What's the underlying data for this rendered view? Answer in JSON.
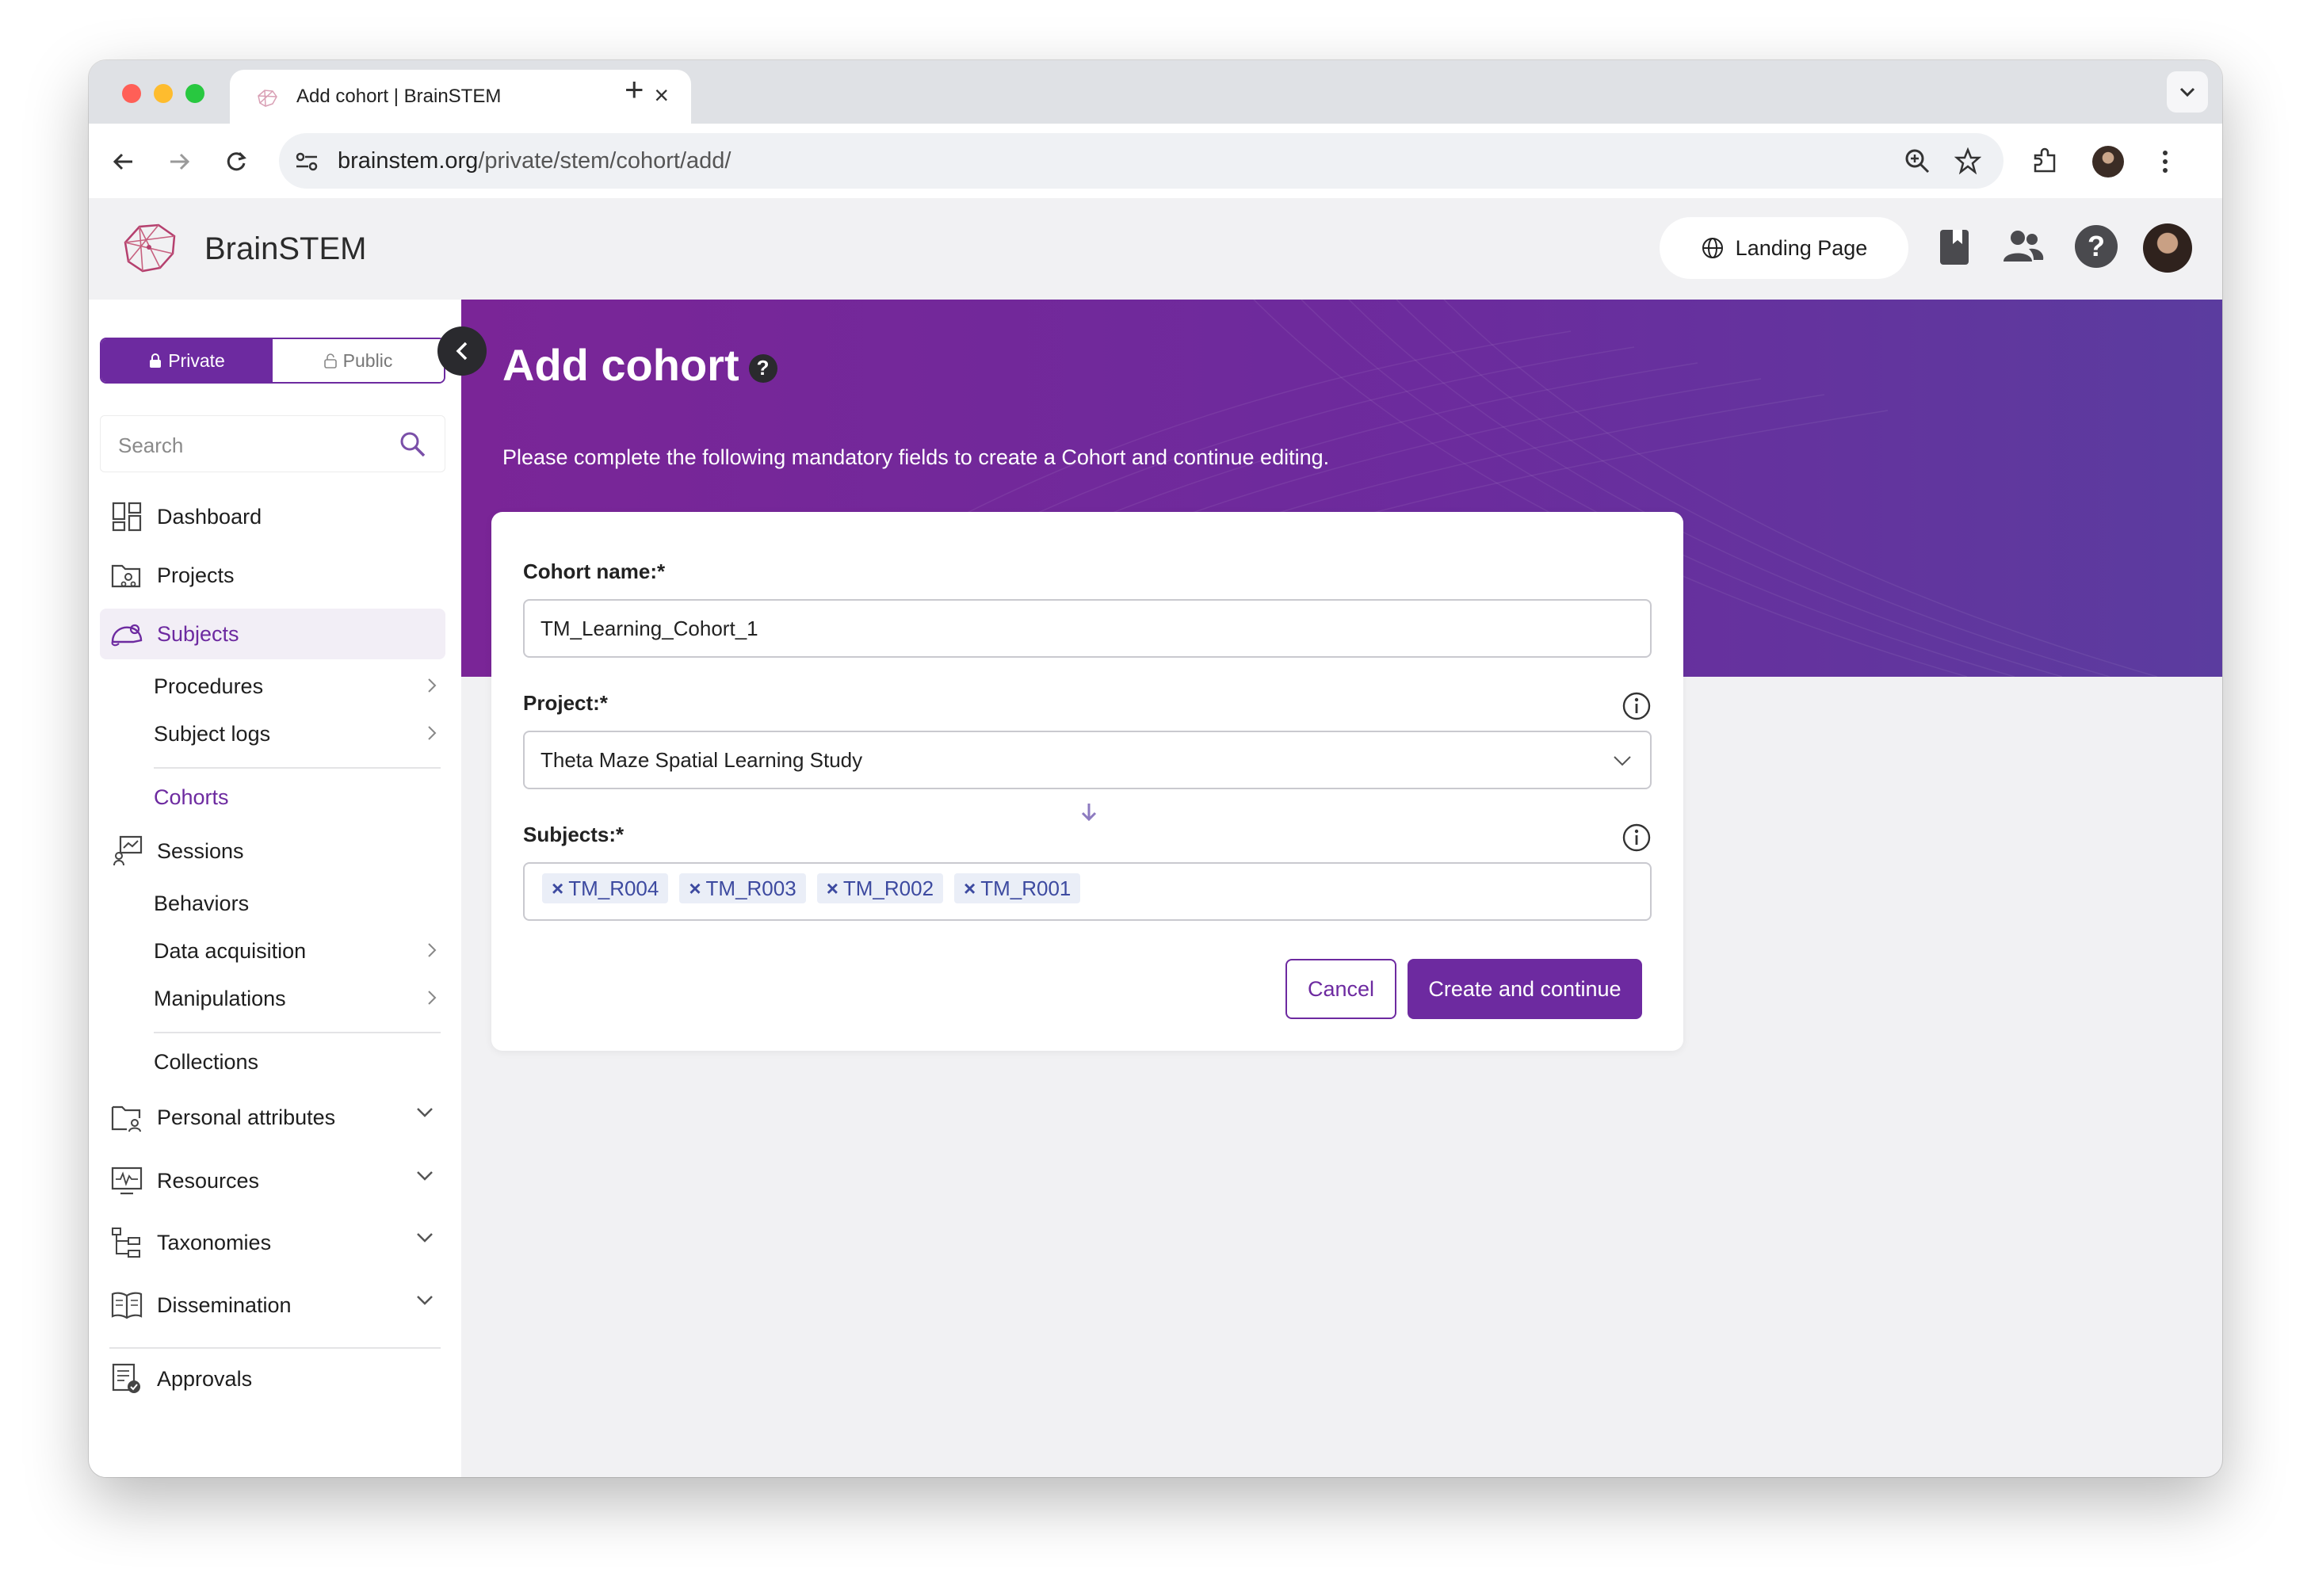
{
  "browser": {
    "tab_title": "Add cohort | BrainSTEM",
    "tab_close": "×",
    "new_tab": "+",
    "url_host": "brainstem.org",
    "url_path": "/private/stem/cohort/add/"
  },
  "header": {
    "brand": "BrainSTEM",
    "landing_page": "Landing Page",
    "help_label": "?"
  },
  "sidebar": {
    "mode_private": "Private",
    "mode_public": "Public",
    "search_placeholder": "Search",
    "items": {
      "dashboard": "Dashboard",
      "projects": "Projects",
      "subjects": "Subjects",
      "procedures": "Procedures",
      "subject_logs": "Subject logs",
      "cohorts": "Cohorts",
      "sessions": "Sessions",
      "behaviors": "Behaviors",
      "data_acquisition": "Data acquisition",
      "manipulations": "Manipulations",
      "collections": "Collections",
      "personal_attributes": "Personal attributes",
      "resources": "Resources",
      "taxonomies": "Taxonomies",
      "dissemination": "Dissemination",
      "approvals": "Approvals"
    }
  },
  "main": {
    "title": "Add cohort",
    "help_label": "?",
    "subtitle": "Please complete the following mandatory fields to create a Cohort and continue editing.",
    "form": {
      "cohort_name_label": "Cohort name:*",
      "cohort_name_value": "TM_Learning_Cohort_1",
      "project_label": "Project:*",
      "project_value": "Theta Maze Spatial Learning Study",
      "subjects_label": "Subjects:*",
      "subjects": [
        "TM_R004",
        "TM_R003",
        "TM_R002",
        "TM_R001"
      ],
      "tag_remove": "×",
      "cancel": "Cancel",
      "submit": "Create and continue"
    }
  },
  "colors": {
    "accent": "#6d2aa0",
    "hero_start": "#7a2597",
    "hero_end": "#5b3c9f",
    "tag_bg": "#eaeef7",
    "tag_text": "#3d4aa0"
  }
}
